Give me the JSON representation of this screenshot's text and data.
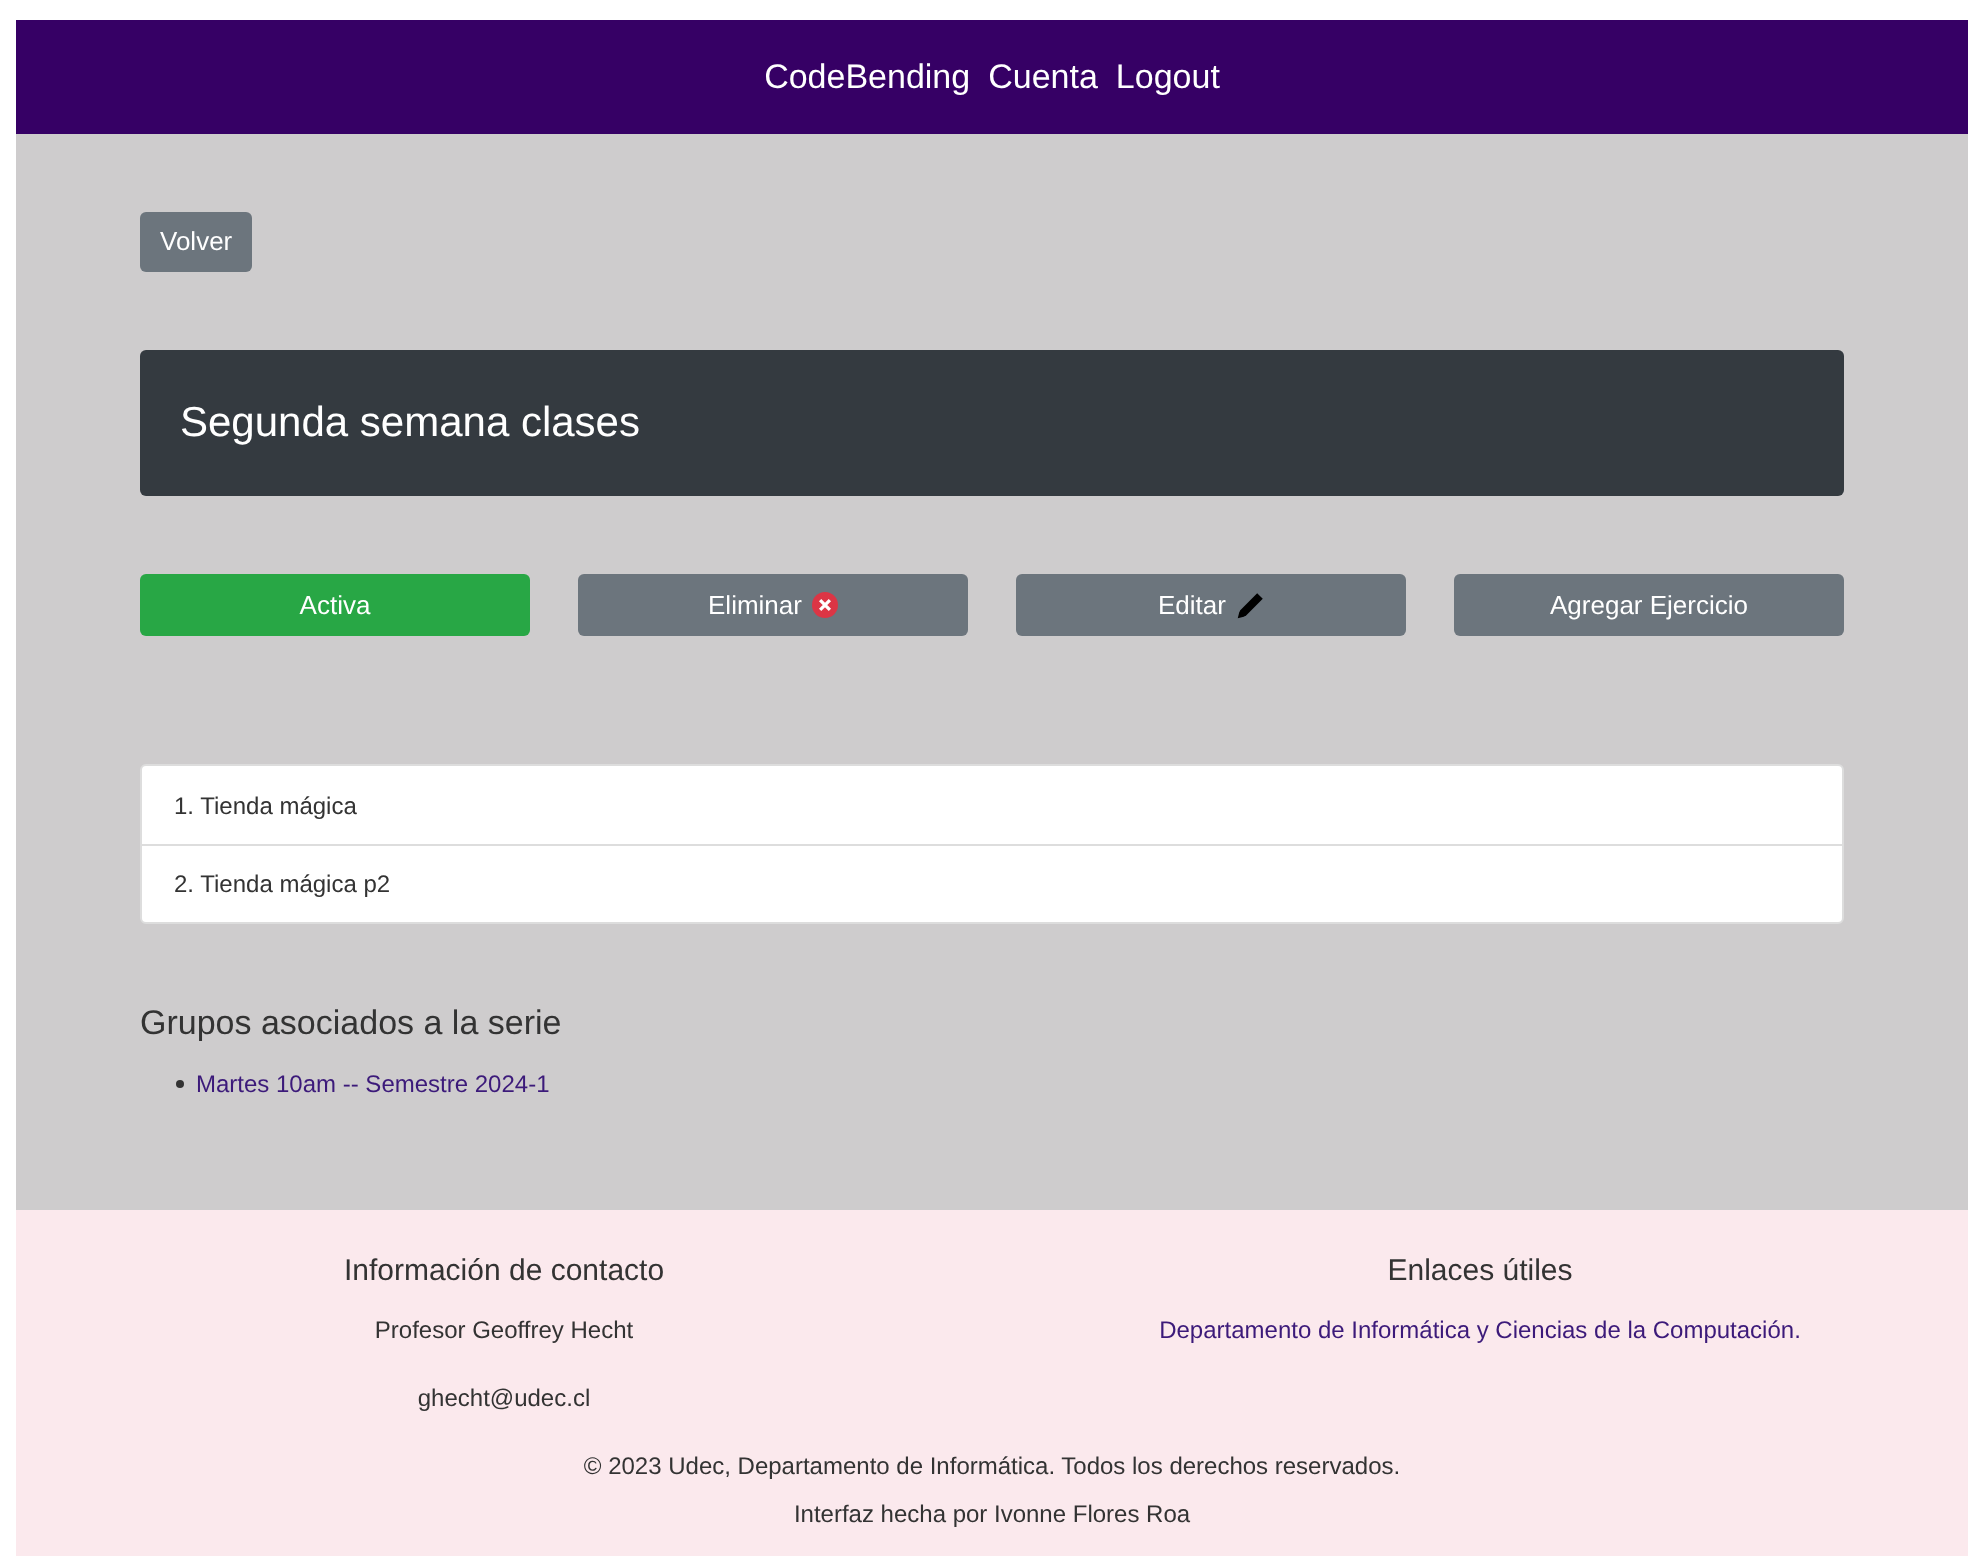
{
  "navbar": {
    "links": [
      "CodeBending",
      "Cuenta",
      "Logout"
    ]
  },
  "back_button": "Volver",
  "series": {
    "title": "Segunda semana clases"
  },
  "actions": [
    {
      "label": "Activa",
      "kind": "status",
      "active": true
    },
    {
      "label": "Eliminar",
      "kind": "delete"
    },
    {
      "label": "Editar",
      "kind": "edit"
    },
    {
      "label": "Agregar Ejercicio",
      "kind": "add"
    }
  ],
  "exercises": [
    "1. Tienda mágica",
    "2. Tienda mágica p2"
  ],
  "groups": {
    "heading": "Grupos asociados a la serie",
    "items": [
      "Martes 10am -- Semestre 2024-1"
    ]
  },
  "footer": {
    "contact": {
      "heading": "Información de contacto",
      "name": "Profesor Geoffrey Hecht",
      "email": "ghecht@udec.cl"
    },
    "links": {
      "heading": "Enlaces útiles",
      "items": [
        "Departamento de Informática y Ciencias de la Computación."
      ]
    },
    "copyright": "© 2023 Udec, Departamento de Informática. Todos los derechos reservados.",
    "credit": "Interfaz hecha por Ivonne Flores Roa"
  }
}
